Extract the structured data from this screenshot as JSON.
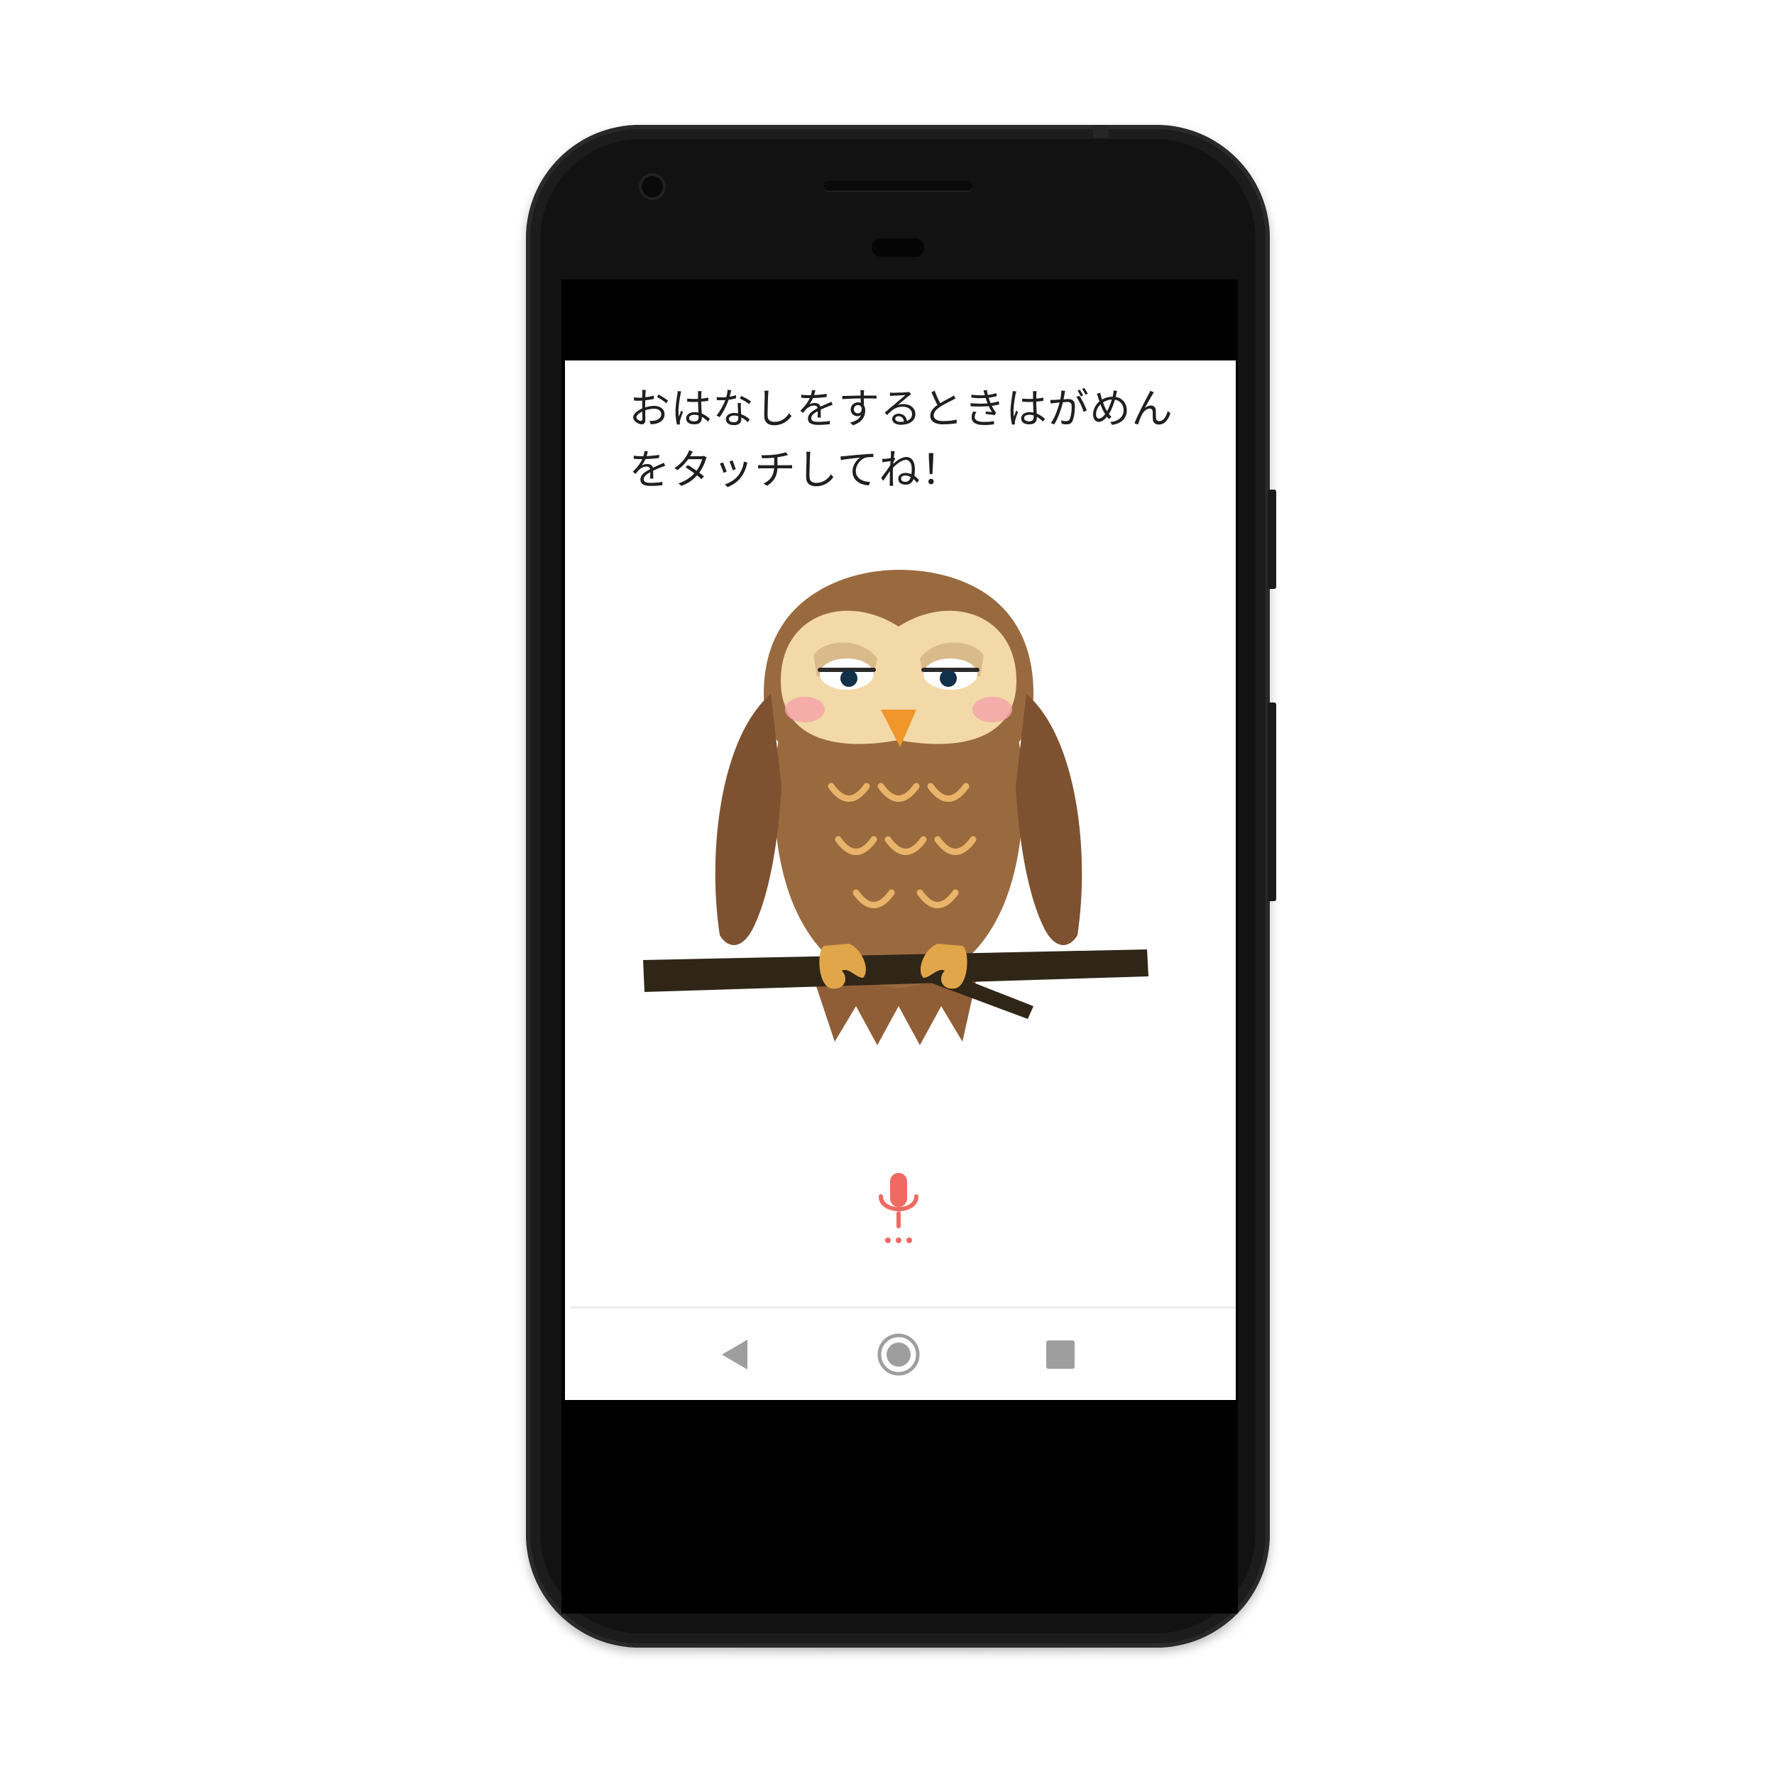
{
  "screen": {
    "instruction_text": "おはなしをするときはがめんをタッチしてね！"
  },
  "illustration": {
    "subject": "owl-on-branch",
    "colors": {
      "body": "#9a6a3f",
      "wing": "#8a5a32",
      "face": "#f3d9a8",
      "beak": "#f0962a",
      "cheek": "#f3a4a8",
      "feather_marks": "#e9b46a",
      "branch": "#2f2618",
      "feet": "#e2a64a"
    }
  },
  "mic": {
    "icon": "microphone-icon",
    "color": "#f06a62"
  },
  "navigation_bar": {
    "back_icon": "back-triangle-icon",
    "home_icon": "home-circle-icon",
    "recents_icon": "recents-square-icon",
    "icon_color": "#9e9e9e"
  }
}
